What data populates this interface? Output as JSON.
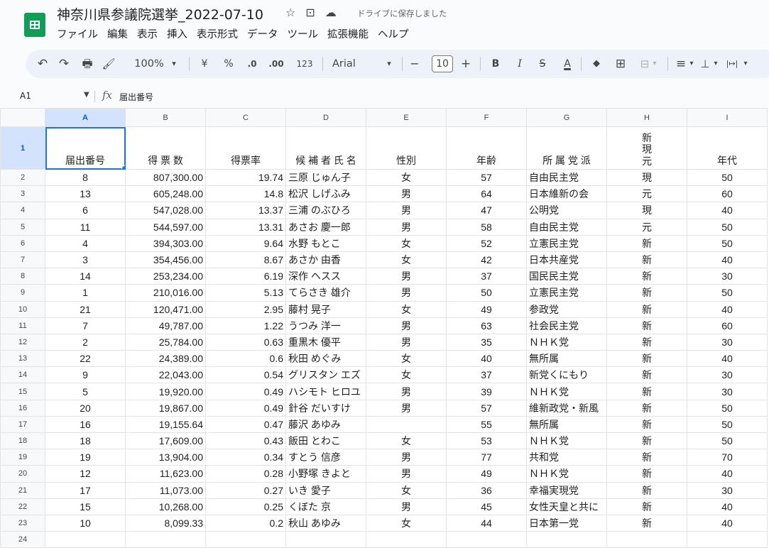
{
  "app": {
    "title": "神奈川県参議院選挙_2022-07-10",
    "save_status": "ドライブに保存しました",
    "menu": [
      "ファイル",
      "編集",
      "表示",
      "挿入",
      "表示形式",
      "データ",
      "ツール",
      "拡張機能",
      "ヘルプ"
    ]
  },
  "toolbar": {
    "undo": "↶",
    "redo": "↷",
    "print": "🖶",
    "paint_format": "🖌",
    "zoom": "100%",
    "currency": "¥",
    "percent": "%",
    "dec_decrease": ".0",
    "dec_increase": ".00",
    "more_formats": "123",
    "font": "Arial",
    "minus": "−",
    "font_size": "10",
    "plus": "+",
    "bold": "B",
    "italic": "I",
    "strike": "S",
    "text_color": "A",
    "fill": "◆",
    "borders": "⊞",
    "merge": "⊟",
    "halign": "≡",
    "valign": "⊥",
    "wrap": "|↦|",
    "caret": "▾"
  },
  "formula_bar": {
    "cell_ref": "A1",
    "fx": "fx",
    "content": "届出番号"
  },
  "columns": [
    "A",
    "B",
    "C",
    "D",
    "E",
    "F",
    "G",
    "H",
    "I"
  ],
  "header_row": {
    "num": "1",
    "cells": [
      "届出番号",
      "得 票 数",
      "得票率",
      "候 補 者 氏 名",
      "性別",
      "年齢",
      "所 属 党 派",
      "新\n現\n元",
      "年代"
    ]
  },
  "rows": [
    {
      "num": "2",
      "cells": [
        "8",
        "807,300.00",
        "19.74",
        "三原 じゅん子",
        "女",
        "57",
        "自由民主党",
        "現",
        "50"
      ]
    },
    {
      "num": "3",
      "cells": [
        "13",
        "605,248.00",
        "14.8",
        "松沢 しげふみ",
        "男",
        "64",
        "日本維新の会",
        "元",
        "60"
      ]
    },
    {
      "num": "4",
      "cells": [
        "6",
        "547,028.00",
        "13.37",
        "三浦 のぶひろ",
        "男",
        "47",
        "公明党",
        "現",
        "40"
      ]
    },
    {
      "num": "5",
      "cells": [
        "11",
        "544,597.00",
        "13.31",
        "あさお 慶一郎",
        "男",
        "58",
        "自由民主党",
        "元",
        "50"
      ]
    },
    {
      "num": "6",
      "cells": [
        "4",
        "394,303.00",
        "9.64",
        "水野 もとこ",
        "女",
        "52",
        "立憲民主党",
        "新",
        "50"
      ]
    },
    {
      "num": "7",
      "cells": [
        "3",
        "354,456.00",
        "8.67",
        "あさか 由香",
        "女",
        "42",
        "日本共産党",
        "新",
        "40"
      ]
    },
    {
      "num": "8",
      "cells": [
        "14",
        "253,234.00",
        "6.19",
        "深作 ヘスス",
        "男",
        "37",
        "国民民主党",
        "新",
        "30"
      ]
    },
    {
      "num": "9",
      "cells": [
        "1",
        "210,016.00",
        "5.13",
        "てらさき 雄介",
        "男",
        "50",
        "立憲民主党",
        "新",
        "50"
      ]
    },
    {
      "num": "10",
      "cells": [
        "21",
        "120,471.00",
        "2.95",
        "藤村 晃子",
        "女",
        "49",
        "参政党",
        "新",
        "40"
      ]
    },
    {
      "num": "11",
      "cells": [
        "7",
        "49,787.00",
        "1.22",
        "うつみ 洋一",
        "男",
        "63",
        "社会民主党",
        "新",
        "60"
      ]
    },
    {
      "num": "12",
      "cells": [
        "2",
        "25,784.00",
        "0.63",
        "重黒木 優平",
        "男",
        "35",
        "ＮＨＫ党",
        "新",
        "30"
      ]
    },
    {
      "num": "13",
      "cells": [
        "22",
        "24,389.00",
        "0.6",
        "秋田 めぐみ",
        "女",
        "40",
        "無所属",
        "新",
        "40"
      ]
    },
    {
      "num": "14",
      "cells": [
        "9",
        "22,043.00",
        "0.54",
        "グリスタン エズ",
        "女",
        "37",
        "新党くにもり",
        "新",
        "30"
      ]
    },
    {
      "num": "15",
      "cells": [
        "5",
        "19,920.00",
        "0.49",
        "ハシモト ヒロユ",
        "男",
        "39",
        "ＮＨＫ党",
        "新",
        "30"
      ]
    },
    {
      "num": "16",
      "cells": [
        "20",
        "19,867.00",
        "0.49",
        "針谷 だいすけ",
        "男",
        "57",
        "維新政党・新風",
        "新",
        "50"
      ]
    },
    {
      "num": "17",
      "cells": [
        "16",
        "19,155.64",
        "0.47",
        "藤沢 あゆみ",
        "",
        "55",
        "無所属",
        "新",
        "50"
      ]
    },
    {
      "num": "18",
      "cells": [
        "18",
        "17,609.00",
        "0.43",
        "飯田 とわこ",
        "女",
        "53",
        "ＮＨＫ党",
        "新",
        "50"
      ]
    },
    {
      "num": "19",
      "cells": [
        "19",
        "13,904.00",
        "0.34",
        "すとう 信彦",
        "男",
        "77",
        "共和党",
        "新",
        "70"
      ]
    },
    {
      "num": "20",
      "cells": [
        "12",
        "11,623.00",
        "0.28",
        "小野塚 きよと",
        "男",
        "49",
        "ＮＨＫ党",
        "新",
        "40"
      ]
    },
    {
      "num": "21",
      "cells": [
        "17",
        "11,073.00",
        "0.27",
        "いき 愛子",
        "女",
        "36",
        "幸福実現党",
        "新",
        "30"
      ]
    },
    {
      "num": "22",
      "cells": [
        "15",
        "10,268.00",
        "0.25",
        "くぼた 京",
        "男",
        "45",
        "女性天皇と共に",
        "新",
        "40"
      ]
    },
    {
      "num": "23",
      "cells": [
        "10",
        "8,099.33",
        "0.2",
        "秋山 あゆみ",
        "女",
        "44",
        "日本第一党",
        "新",
        "40"
      ]
    },
    {
      "num": "24",
      "cells": [
        "",
        "",
        "",
        "",
        "",
        "",
        "",
        "",
        ""
      ]
    }
  ],
  "colors": {
    "sheets_green": "#0f9d58",
    "selection_blue": "#1a73e8",
    "toolbar_bg": "#edf2fa"
  }
}
